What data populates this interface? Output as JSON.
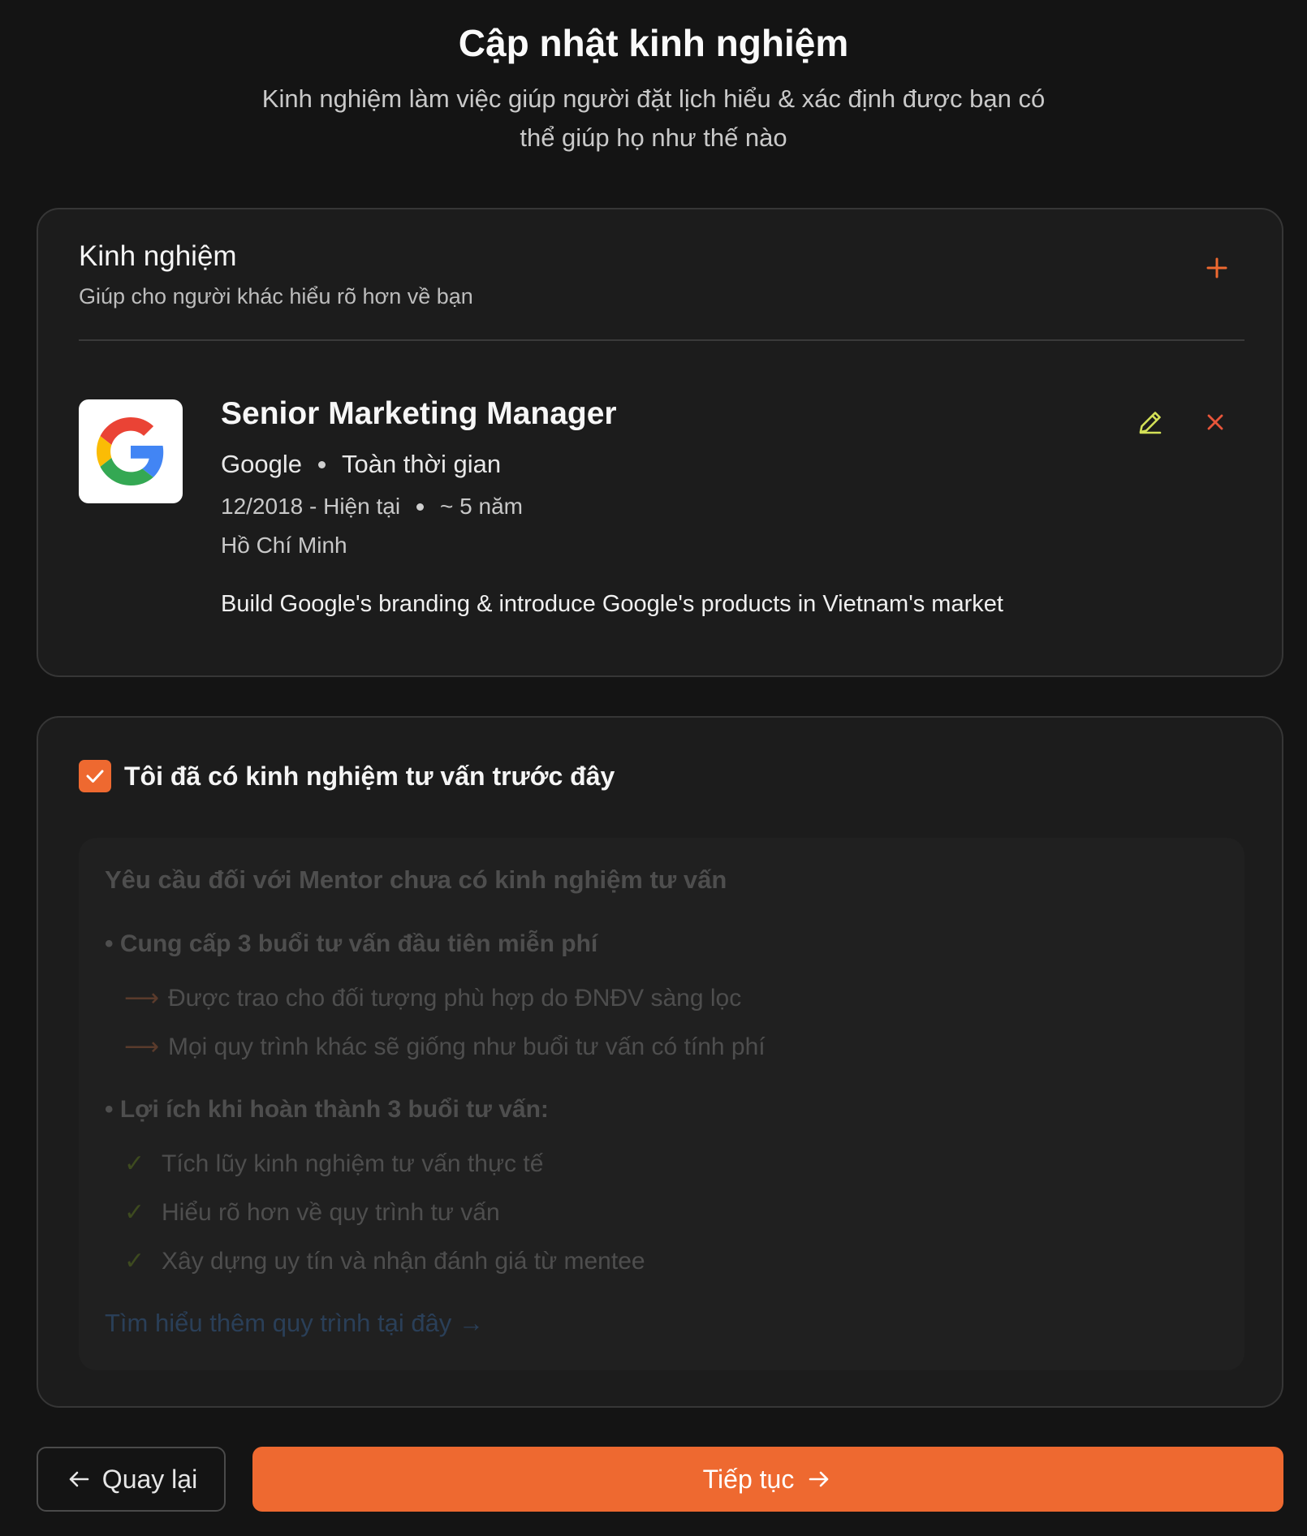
{
  "header": {
    "title": "Cập nhật kinh nghiệm",
    "subtitle": "Kinh nghiệm làm việc giúp người đặt lịch hiểu & xác định được bạn có thể giúp họ như thế nào"
  },
  "experience_section": {
    "title": "Kinh nghiệm",
    "subtitle": "Giúp cho người khác hiểu rõ hơn về bạn",
    "add_icon": "plus-icon",
    "items": [
      {
        "logo": "google-logo",
        "job_title": "Senior Marketing Manager",
        "company": "Google",
        "employment_type": "Toàn thời gian",
        "period": "12/2018 - Hiện tại",
        "duration": "~ 5 năm",
        "location": "Hồ Chí Minh",
        "description": "Build Google's branding & introduce Google's products in Vietnam's market",
        "edit_icon": "pencil-icon",
        "delete_icon": "close-icon"
      }
    ]
  },
  "consult_section": {
    "checkbox_checked": true,
    "checkbox_label": "Tôi đã có kinh nghiệm tư vấn trước đây",
    "info": {
      "title": "Yêu cầu đối với Mentor chưa có kinh nghiệm tư vấn",
      "bullet1": "• Cung cấp 3 buổi tư vấn đầu tiên miễn phí",
      "bullet1_items": [
        "Được trao cho đối tượng phù hợp do ĐNĐV sàng lọc",
        "Mọi quy trình khác sẽ giống như buổi tư vấn có tính phí"
      ],
      "bullet2": "• Lợi ích khi hoàn thành 3 buổi tư vấn:",
      "bullet2_items": [
        "Tích lũy kinh nghiệm tư vấn thực tế",
        "Hiểu rõ hơn về quy trình tư vấn",
        "Xây dựng uy tín và nhận đánh giá từ mentee"
      ],
      "link": "Tìm hiểu thêm quy trình tại đây →"
    }
  },
  "footer": {
    "back_label": "Quay lại",
    "next_label": "Tiếp tục"
  },
  "colors": {
    "accent": "#ee6930",
    "edit": "#d4e157",
    "delete": "#e8553a",
    "background": "#141414"
  }
}
